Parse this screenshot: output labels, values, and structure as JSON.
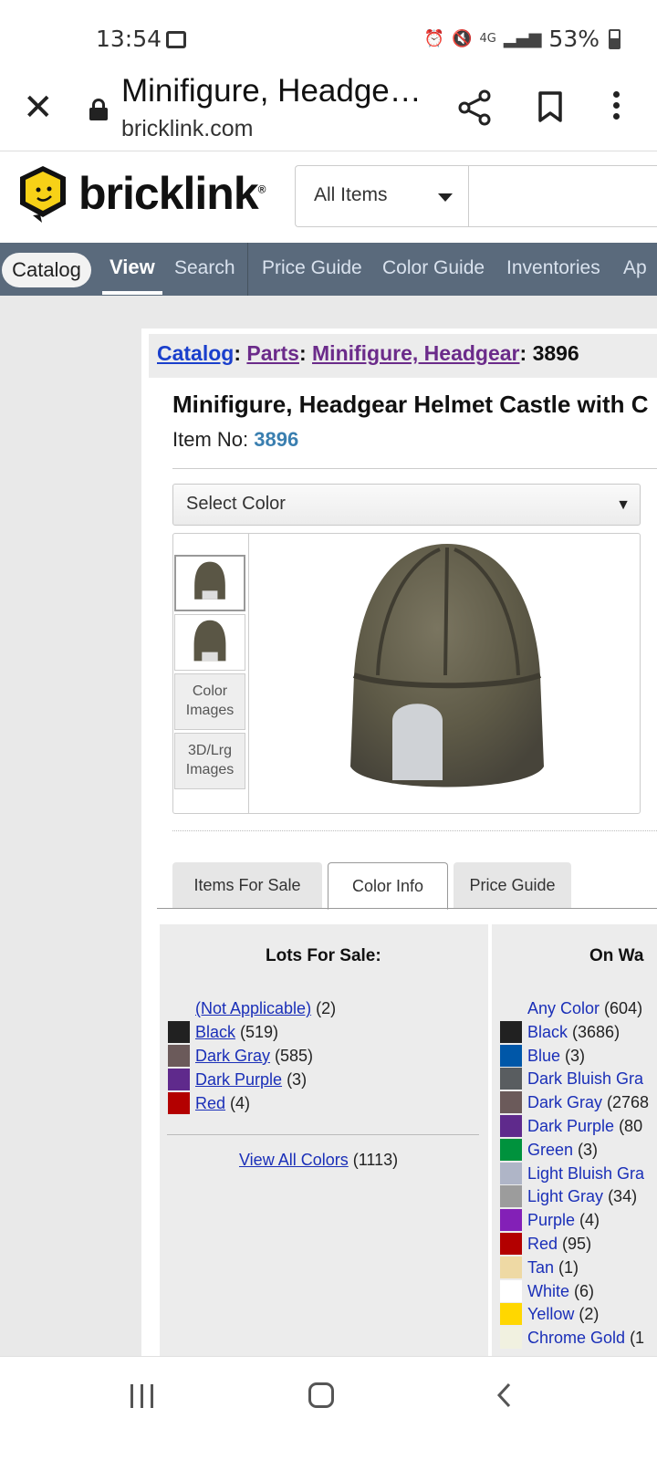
{
  "status": {
    "time": "13:54",
    "network": "4G",
    "battery": "53%"
  },
  "browser": {
    "page_title": "Minifigure, Headge…",
    "domain": "bricklink.com"
  },
  "header": {
    "logo_text": "bricklink",
    "logo_reg": "®",
    "search_scope": "All Items"
  },
  "nav": {
    "items": [
      "Catalog",
      "View",
      "Search",
      "Price Guide",
      "Color Guide",
      "Inventories",
      "Ap"
    ]
  },
  "breadcrumb": {
    "catalog": "Catalog",
    "sep1": ":",
    "parts": "Parts",
    "sep2": ":",
    "category": "Minifigure, Headgear",
    "sep3": ":",
    "item": "3896"
  },
  "item": {
    "title": "Minifigure, Headgear Helmet Castle with C",
    "item_no_label": "Item No:",
    "item_no": "3896"
  },
  "select_color": {
    "label": "Select Color",
    "arrow": "▼"
  },
  "thumbs": {
    "color_images": "Color Images",
    "lrg_images": "3D/Lrg Images"
  },
  "tabs": [
    "Items For Sale",
    "Color Info",
    "Price Guide"
  ],
  "active_tab": "Color Info",
  "lots_for_sale": {
    "title": "Lots For Sale:",
    "rows": [
      {
        "name": "(Not Applicable)",
        "count": "(2)",
        "color": ""
      },
      {
        "name": "Black",
        "count": "(519)",
        "color": "#212121"
      },
      {
        "name": "Dark Gray",
        "count": "(585)",
        "color": "#6b5a5a"
      },
      {
        "name": "Dark Purple",
        "count": "(3)",
        "color": "#5f2a8c"
      },
      {
        "name": "Red",
        "count": "(4)",
        "color": "#b30000"
      }
    ],
    "view_all": "View All Colors",
    "view_all_count": "(1113)"
  },
  "on_wanted": {
    "title": "On Wa",
    "rows": [
      {
        "name": "Any Color",
        "count": "(604)",
        "color": ""
      },
      {
        "name": "Black",
        "count": "(3686)",
        "color": "#212121"
      },
      {
        "name": "Blue",
        "count": "(3)",
        "color": "#0057a8"
      },
      {
        "name": "Dark Bluish Gra",
        "count": "",
        "color": "#595d60"
      },
      {
        "name": "Dark Gray",
        "count": "(2768",
        "color": "#6b5a5a"
      },
      {
        "name": "Dark Purple",
        "count": "(80",
        "color": "#5f2a8c"
      },
      {
        "name": "Green",
        "count": "(3)",
        "color": "#00923d"
      },
      {
        "name": "Light Bluish Gra",
        "count": "",
        "color": "#afb5c7"
      },
      {
        "name": "Light Gray",
        "count": "(34)",
        "color": "#9c9c9c"
      },
      {
        "name": "Purple",
        "count": "(4)",
        "color": "#8320b7"
      },
      {
        "name": "Red",
        "count": "(95)",
        "color": "#b30000"
      },
      {
        "name": "Tan",
        "count": "(1)",
        "color": "#eed9a4"
      },
      {
        "name": "White",
        "count": "(6)",
        "color": "#ffffff"
      },
      {
        "name": "Yellow",
        "count": "(2)",
        "color": "#ffd700"
      },
      {
        "name": "Chrome Gold",
        "count": "(1",
        "color": "#f1f1e0"
      }
    ]
  },
  "colors": {
    "nav_bg": "#5a6a7c",
    "link_blue": "#1a2fb8",
    "link_purple": "#6b2b8a",
    "item_no": "#3a7fb0",
    "logo_yellow": "#f7d117"
  }
}
